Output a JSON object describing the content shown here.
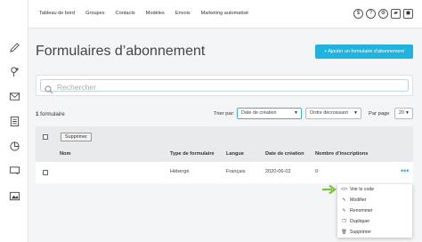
{
  "nav": {
    "items": [
      "Tableau de bord",
      "Groupes",
      "Contacts",
      "Modèles",
      "Envois",
      "Marketing automatisé"
    ]
  },
  "topbar_icons": [
    {
      "name": "billing-icon",
      "glyph": "$"
    },
    {
      "name": "help-icon",
      "glyph": "?"
    },
    {
      "name": "settings-icon",
      "glyph": "⚙"
    },
    {
      "name": "files-icon",
      "glyph": "▰"
    },
    {
      "name": "account-icon",
      "glyph": "◼"
    }
  ],
  "page": {
    "title": "Formulaires d’abonnement",
    "add_button": "+ Ajouter un formulaire d’abonnement"
  },
  "search": {
    "placeholder": "Rechercher"
  },
  "toolbar": {
    "count_number": "1",
    "count_label": " formulaire",
    "sort_label": "Trier par:",
    "sort_field": "Date de création",
    "sort_order": "Ordre décroissant",
    "per_page_label": "Par page",
    "per_page_value": "20"
  },
  "table": {
    "delete_button": "Supprimer",
    "headers": [
      "Nom",
      "Type de formulaire",
      "Langue",
      "Date de création",
      "Nombre d’inscriptions"
    ],
    "rows": [
      {
        "name": "",
        "type": "Hébergé",
        "language": "Français",
        "created": "2020-06-02",
        "signups": "0"
      }
    ],
    "row_menu_glyph": "•••"
  },
  "row_menu": {
    "items": [
      {
        "icon": "</>",
        "label": "Voir le code"
      },
      {
        "icon": "✎",
        "label": "Modifier"
      },
      {
        "icon": "✎",
        "label": "Renommer"
      },
      {
        "icon": "❐",
        "label": "Dupliquer"
      },
      {
        "icon": "🗑",
        "label": "Supprimer"
      }
    ]
  },
  "colors": {
    "accent": "#1fb3dd",
    "arrow": "#7bc043"
  }
}
